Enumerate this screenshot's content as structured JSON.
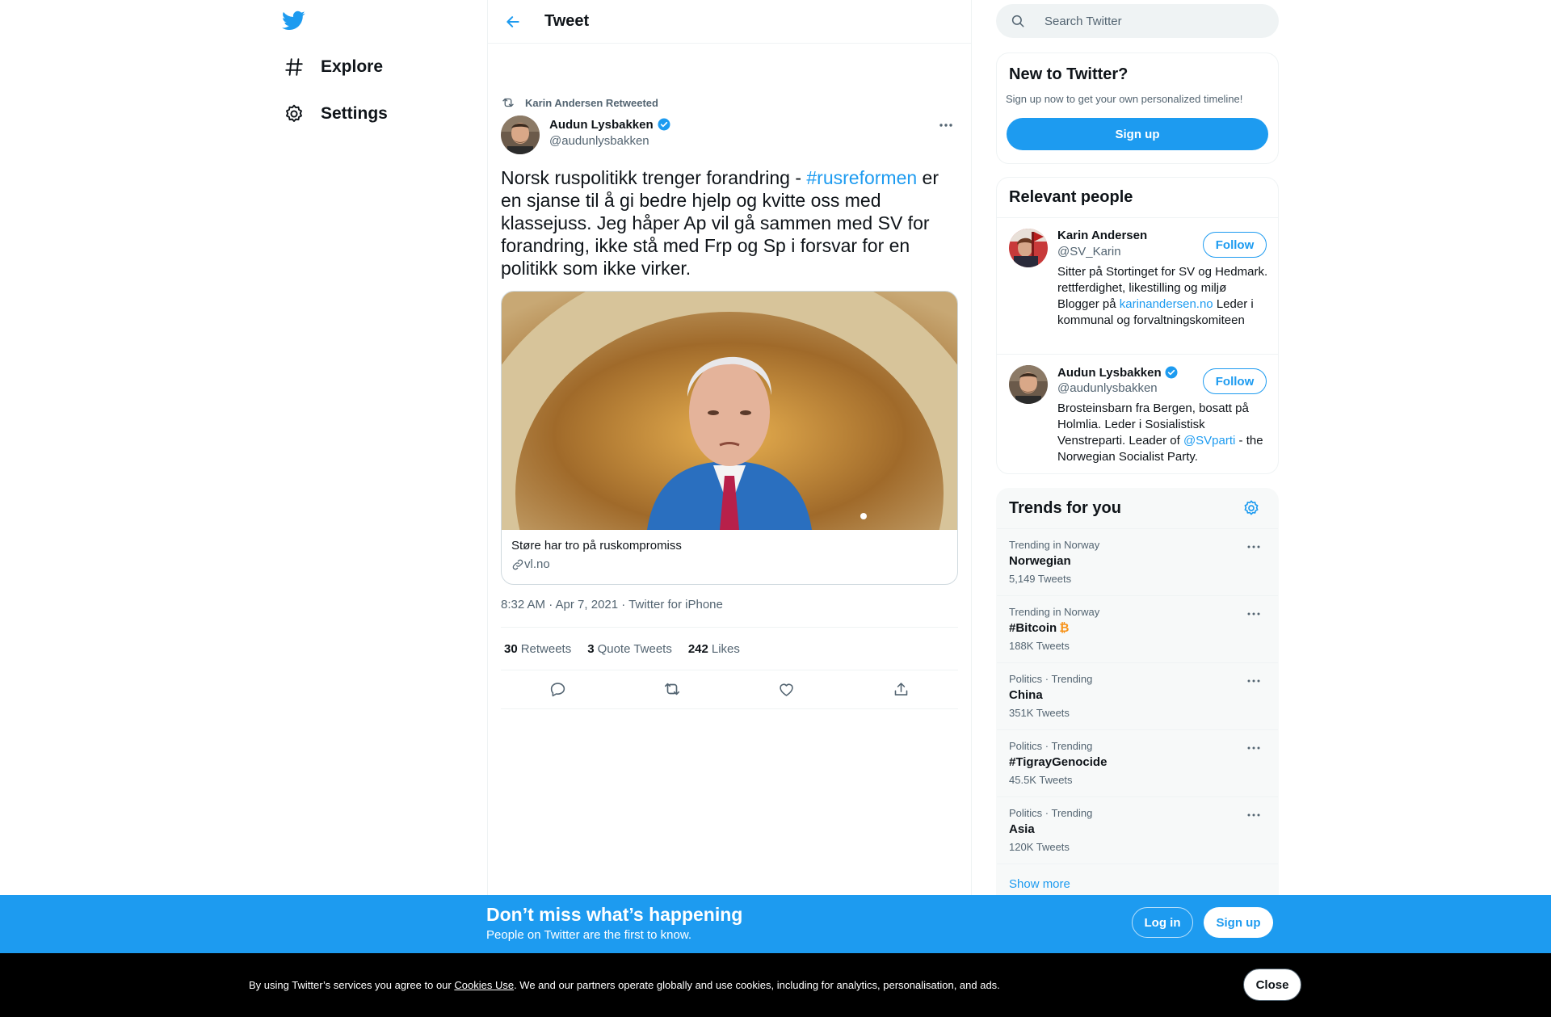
{
  "nav": {
    "logo_icon": "twitter-bird-icon",
    "items": [
      {
        "label": "Explore",
        "icon": "hashtag-icon"
      },
      {
        "label": "Settings",
        "icon": "gear-icon"
      }
    ]
  },
  "header": {
    "title": "Tweet",
    "back_icon": "arrow-left-icon"
  },
  "tweet": {
    "retweeted_by": "Karin Andersen Retweeted",
    "author_name": "Audun Lysbakken",
    "author_handle": "@audunlysbakken",
    "verified": true,
    "text_before": "Norsk ruspolitikk trenger forandring - ",
    "hashtag": "#rusreformen",
    "text_after": " er en sjanse til å gi bedre hjelp og kvitte oss med klassejuss. Jeg håper Ap vil gå sammen med SV for forandring, ikke stå med Frp og Sp i forsvar for en politikk som ikke virker.",
    "card": {
      "title": "Støre har tro på ruskompromiss",
      "domain": "vl.no"
    },
    "timestamp": "8:32 AM · Apr 7, 2021 · Twitter for iPhone",
    "stats": [
      {
        "count": "30",
        "label": "Retweets"
      },
      {
        "count": "3",
        "label": "Quote Tweets"
      },
      {
        "count": "242",
        "label": "Likes"
      }
    ]
  },
  "search": {
    "placeholder": "Search Twitter"
  },
  "new_to_twitter": {
    "title": "New to Twitter?",
    "subtitle": "Sign up now to get your own personalized timeline!",
    "signup_label": "Sign up"
  },
  "relevant_people": {
    "title": "Relevant people",
    "follow_label": "Follow",
    "people": [
      {
        "name": "Karin Andersen",
        "handle": "@SV_Karin",
        "verified": false,
        "bio_before": "Sitter på Stortinget for SV og Hedmark. rettferdighet, likestilling og miljø Blogger på ",
        "bio_link": "karinandersen.no",
        "bio_after": " Leder i kommunal og forvaltningskomiteen"
      },
      {
        "name": "Audun Lysbakken",
        "handle": "@audunlysbakken",
        "verified": true,
        "bio_before": "Brosteinsbarn fra Bergen, bosatt på Holmlia. Leder i Sosialistisk Venstreparti. Leader of ",
        "bio_link": "@SVparti",
        "bio_after": " - the Norwegian Socialist Party."
      }
    ]
  },
  "trends": {
    "title": "Trends for you",
    "items": [
      {
        "context": "Trending in Norway",
        "name": "Norwegian",
        "count": "5,149 Tweets"
      },
      {
        "context": "Trending in Norway",
        "name": "#Bitcoin",
        "count": "188K Tweets",
        "emoji": "₿"
      },
      {
        "context": "Politics · Trending",
        "name": "China",
        "count": "351K Tweets"
      },
      {
        "context": "Politics · Trending",
        "name": "#TigrayGenocide",
        "count": "45.5K Tweets"
      },
      {
        "context": "Politics · Trending",
        "name": "Asia",
        "count": "120K Tweets"
      }
    ],
    "show_more": "Show more"
  },
  "banner": {
    "headline": "Don’t miss what’s happening",
    "subline": "People on Twitter are the first to know.",
    "login_label": "Log in",
    "signup_label": "Sign up"
  },
  "cookie": {
    "before": "By using Twitter’s services you agree to our ",
    "link": "Cookies Use",
    "after": ". We and our partners operate globally and use cookies, including for analytics, personalisation, and ads.",
    "close_label": "Close"
  },
  "colors": {
    "accent": "#1d9bf0",
    "text": "#0f1419",
    "secondary": "#536471",
    "border": "#eff3f4"
  }
}
